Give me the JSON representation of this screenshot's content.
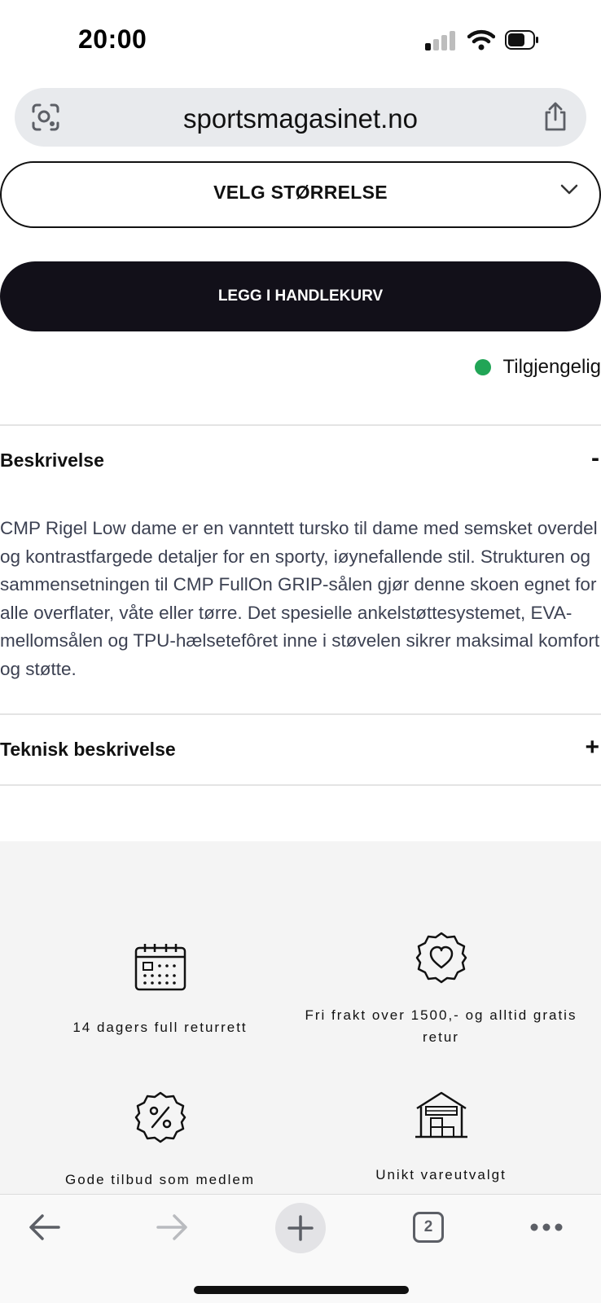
{
  "status_bar": {
    "time": "20:00"
  },
  "browser": {
    "url": "sportsmagasinet.no",
    "tab_count": "2"
  },
  "product": {
    "size_select_label": "VELG STØRRELSE",
    "add_to_cart_label": "LEGG I HANDLEKURV",
    "availability": "Tilgjengelig",
    "availability_color": "#21a556"
  },
  "sections": {
    "description": {
      "title": "Beskrivelse",
      "toggle": "-",
      "text": "CMP Rigel Low dame er en vanntett tursko til dame med semsket overdel og kontrastfargede detaljer for en sporty, iøynefallende stil. Strukturen og sammensetningen til CMP FullOn GRIP-sålen gjør denne skoen egnet for alle overflater, våte eller tørre. Det spesielle ankelstøttesystemet, EVA-mellomsålen og TPU-hælsetefôret inne i støvelen sikrer maksimal komfort og støtte."
    },
    "technical": {
      "title": "Teknisk beskrivelse",
      "toggle": "+"
    }
  },
  "benefits": [
    {
      "icon": "calendar-icon",
      "text": "14 dagers full returrett"
    },
    {
      "icon": "heart-badge-icon",
      "text": "Fri frakt over 1500,- og alltid gratis retur"
    },
    {
      "icon": "percent-badge-icon",
      "text": "Gode tilbud som medlem"
    },
    {
      "icon": "warehouse-icon",
      "text": "Unikt vareutvalgt"
    }
  ],
  "colors": {
    "button_dark": "#121019",
    "body_text": "#3c4152",
    "section_bg": "#f4f4f4"
  }
}
